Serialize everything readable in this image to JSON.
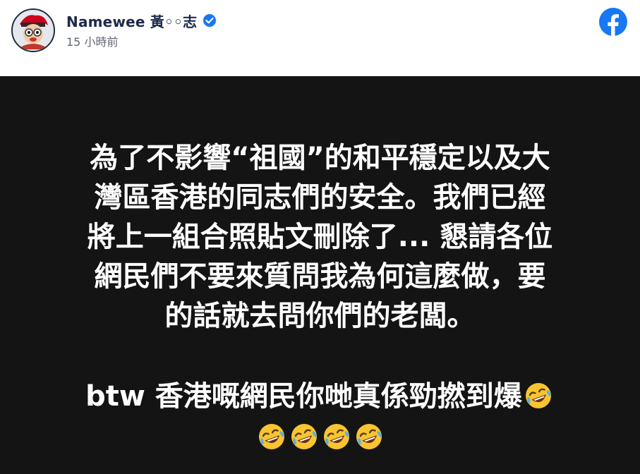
{
  "header": {
    "name": "Namewee 黃◦◦志",
    "timestamp": "15 小時前",
    "verified": true,
    "app_icon": "facebook-logo-icon",
    "brand_color": "#1877f2"
  },
  "post": {
    "background_color": "#141414",
    "text_color": "#ffffff",
    "lines": [
      "為了不影響“祖國”的和平穩定以及大",
      "灣區香港的同志們的安全。我們已經",
      "將上一組合照貼文刪除了... 懇請各位",
      "網民們不要來質問我為何這麼做，要",
      "的話就去問你們的老闆。"
    ],
    "line6": "btw 香港嘅網民你哋真係勁撚到爆",
    "emoji_name": "rolling-on-the-floor-laughing-icon",
    "emoji_count_line6": 1,
    "emoji_count_line7": 4
  }
}
